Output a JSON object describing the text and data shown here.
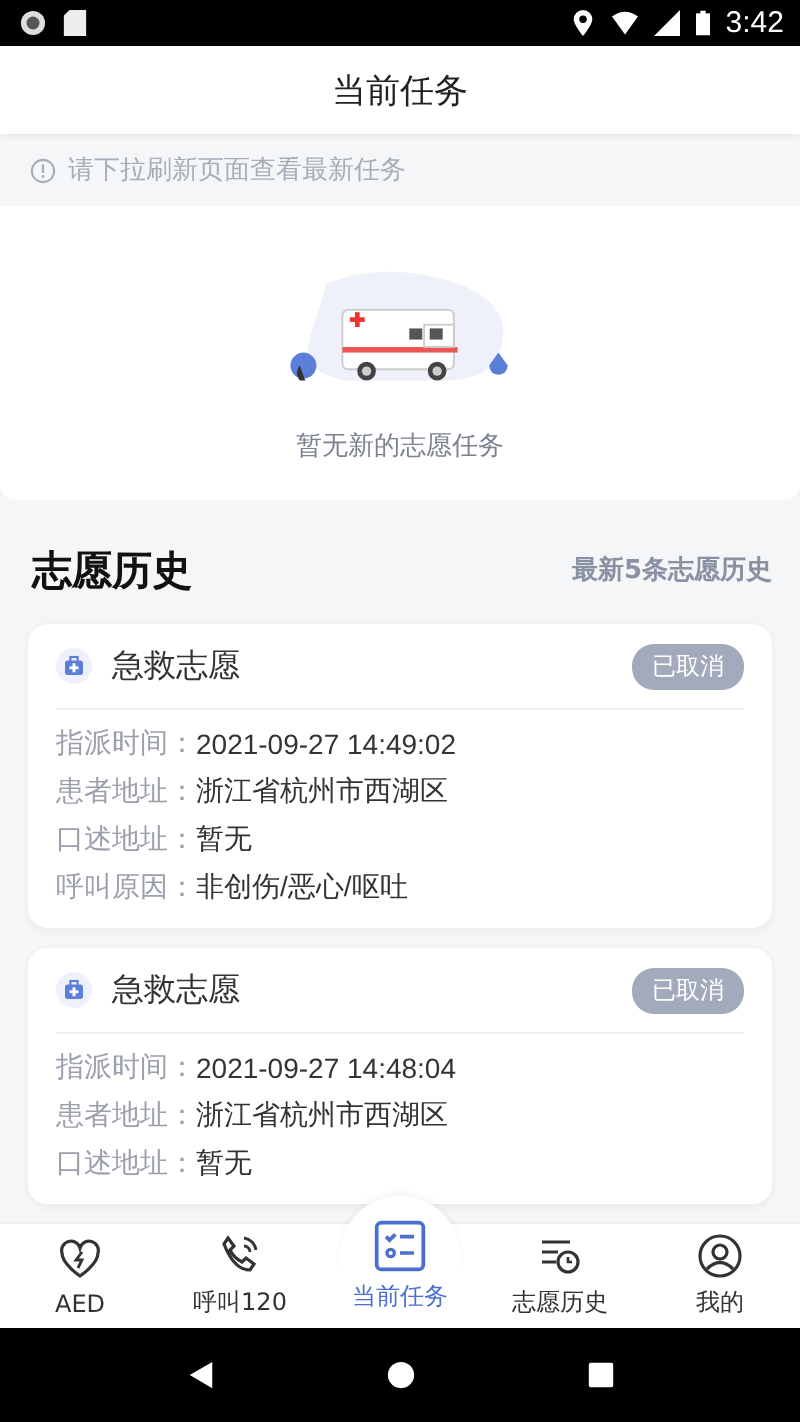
{
  "status_bar": {
    "time": "3:42"
  },
  "header": {
    "title": "当前任务"
  },
  "notice": {
    "text": "请下拉刷新页面查看最新任务"
  },
  "empty_state": {
    "text": "暂无新的志愿任务"
  },
  "history": {
    "title": "志愿历史",
    "subtitle": "最新5条志愿历史",
    "records": [
      {
        "type": "急救志愿",
        "status": "已取消",
        "fields": [
          {
            "label": "指派时间：",
            "value": "2021-09-27 14:49:02"
          },
          {
            "label": "患者地址：",
            "value": "浙江省杭州市西湖区"
          },
          {
            "label": "口述地址：",
            "value": "暂无"
          },
          {
            "label": "呼叫原因：",
            "value": "非创伤/恶心/呕吐"
          }
        ]
      },
      {
        "type": "急救志愿",
        "status": "已取消",
        "fields": [
          {
            "label": "指派时间：",
            "value": "2021-09-27 14:48:04"
          },
          {
            "label": "患者地址：",
            "value": "浙江省杭州市西湖区"
          },
          {
            "label": "口述地址：",
            "value": "暂无"
          }
        ]
      }
    ]
  },
  "tab_bar": {
    "tabs": [
      {
        "label": "AED",
        "selected": false
      },
      {
        "label": "呼叫120",
        "selected": false
      },
      {
        "label": "当前任务",
        "selected": true
      },
      {
        "label": "志愿历史",
        "selected": false
      },
      {
        "label": "我的",
        "selected": false
      }
    ]
  }
}
